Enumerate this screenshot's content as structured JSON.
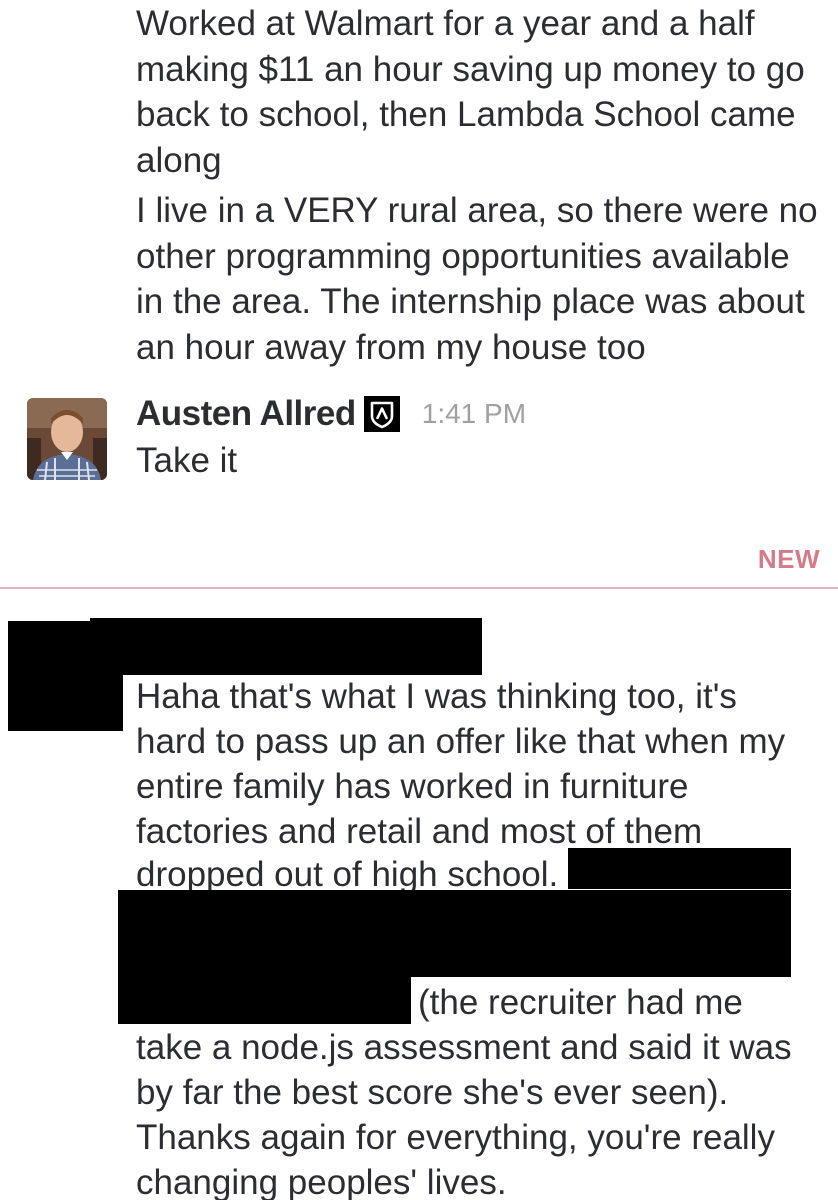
{
  "messages": {
    "previous": {
      "paragraph_1": "Worked at Walmart for a year and a half making $11 an hour saving up money to go back to school, then Lambda School came along",
      "paragraph_2": "I live in a VERY rural area, so there were no other programming opportunities available in the area. The internship place was about an hour away from my house too"
    },
    "austen": {
      "sender": "Austen Allred",
      "timestamp": "1:41 PM",
      "text": "Take it",
      "avatar_icon": "user-avatar-photo",
      "badge_icon": "lambda-shield-badge-icon"
    },
    "divider": {
      "label": "NEW",
      "color": "#d47a89"
    },
    "reply": {
      "lines": [
        "Haha that's what I was thinking too, it's",
        "hard to pass up an offer like that when my",
        "entire family has worked in furniture",
        "factories and retail and most of them",
        "dropped out of high school.",
        "(the recruiter had me",
        "take a node.js assessment and said it was",
        "by far the best score she's ever seen).",
        "Thanks again for everything, you're really",
        "changing peoples' lives."
      ]
    }
  }
}
